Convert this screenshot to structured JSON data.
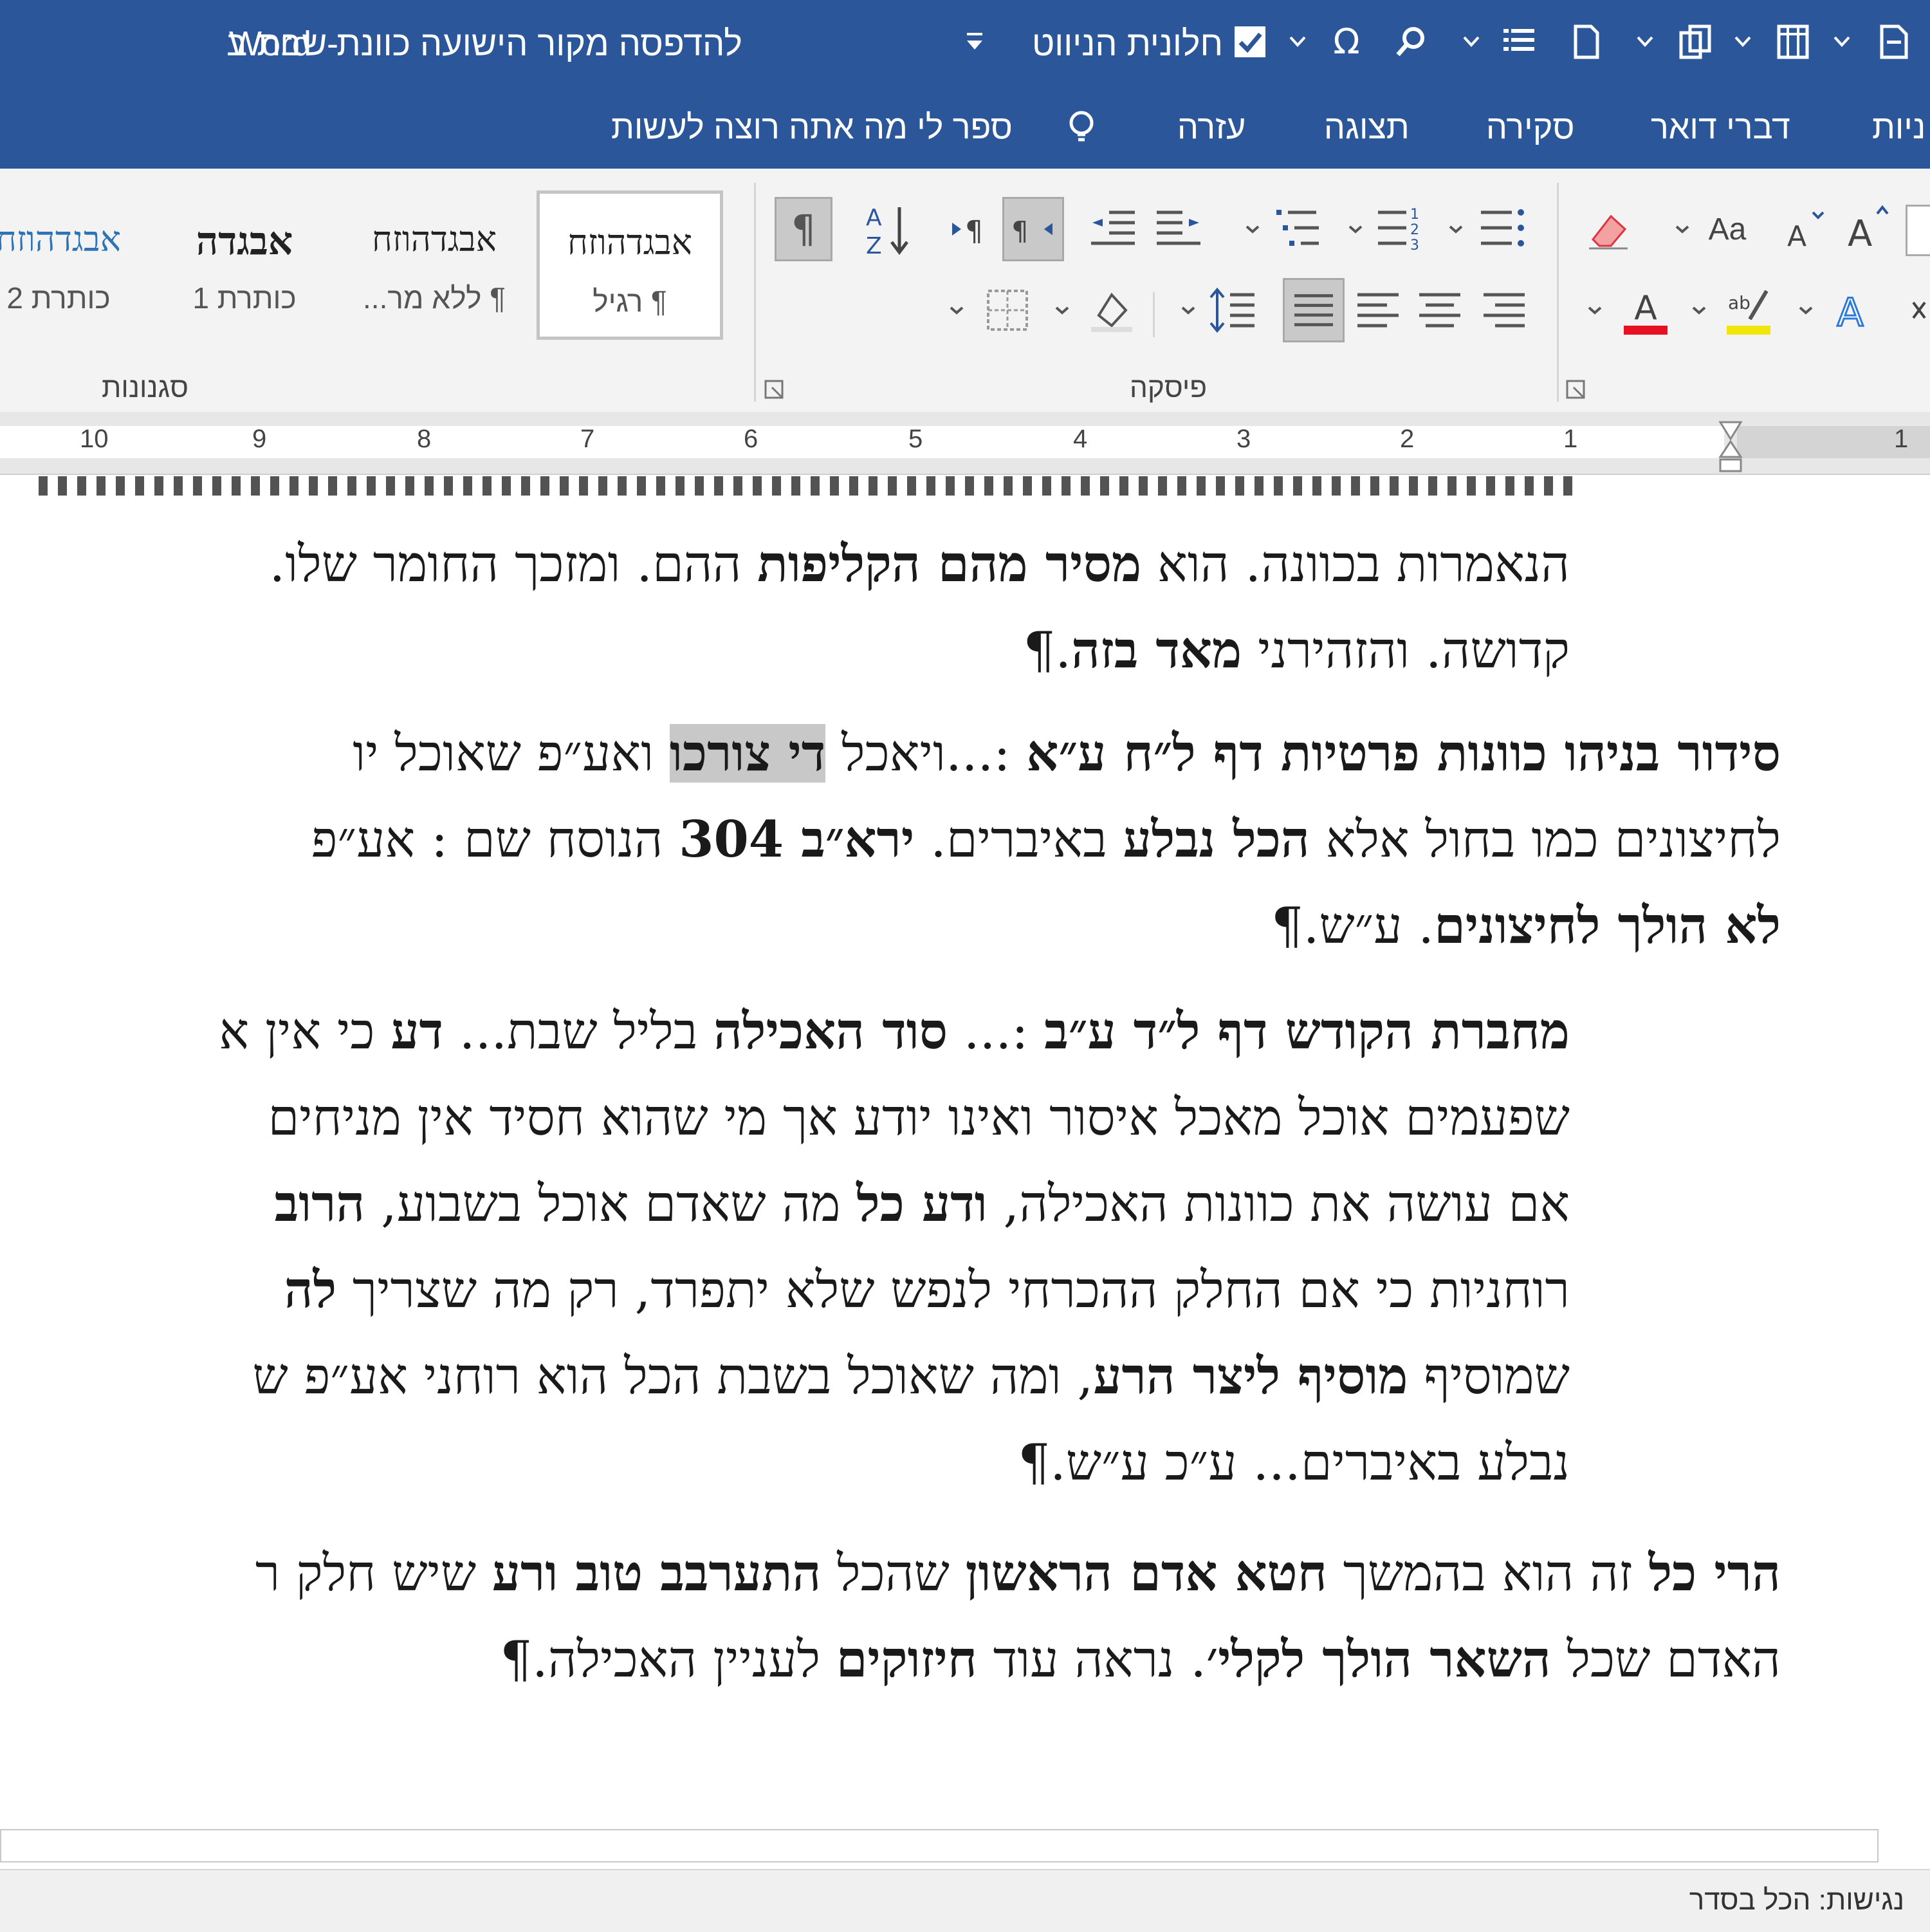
{
  "window": {
    "app": "Word",
    "separator": "-",
    "doc_title": "להדפסה מקור הישועה כוונת שבת ב",
    "nav_pane_label": "חלונית הניווט",
    "nav_pane_checked": true
  },
  "tabs": [
    "עזרה",
    "תצוגה",
    "סקירה",
    "דברי דואר",
    "ניות"
  ],
  "tell_me": "ספר לי מה אתה רוצה לעשות",
  "ribbon": {
    "groups": {
      "styles": "סגנונות",
      "paragraph": "פיסקה"
    },
    "styles": [
      {
        "sample": "אבגדהוזח",
        "name": "¶ רגיל",
        "selected": true
      },
      {
        "sample": "אבגדהוזח",
        "name": "¶ ללא מר...",
        "selected": false
      },
      {
        "sample": "אבגדה",
        "name": "כותרת 1",
        "selected": false
      },
      {
        "sample": "אבגדהוזח",
        "name": "כותרת 2",
        "selected": false
      }
    ],
    "font_case_label": "Aa"
  },
  "ruler": {
    "numbers": [
      "10",
      "9",
      "8",
      "7",
      "6",
      "5",
      "4",
      "3",
      "2",
      "1",
      "1"
    ]
  },
  "document": {
    "p0": {
      "l0a": "הנאמרות בכוונה. הוא ",
      "l0b": "מסיר מהם הקליפות",
      "l0c": " ההם. ומזכך החומר שלו.",
      "l1a": "קדושה. והזהירני ",
      "l1b": "מאד בזה",
      "l1c": ".¶"
    },
    "p1": {
      "l0a": "סידור בניהו כוונות פרטיות דף ל״ח ע״א",
      "l0b": " :...ויאכל ",
      "l0c": "די צורכו",
      "l0d": " ואע״פ שאוכל יו",
      "l1a": "לחיצונים כמו בחול אלא ",
      "l1b": "הכל נבלע",
      "l1c": " באיברים. ",
      "l1d": "ירא״ב 304",
      "l1e": " הנוסח שם : אע״פ",
      "l2a": "לא הולך לחיצונים",
      "l2b": ". ע״ש.¶"
    },
    "p2": {
      "l0a": "מחברת הקודש דף ל״ד ע״ב",
      "l0b": " :... ",
      "l0c": "סוד האכילה",
      "l0d": " בליל שבת... ",
      "l0e": "דע",
      "l0f": " כי אין א",
      "l1": "שפעמים אוכל מאכל איסור ואינו יודע אך מי שהוא חסיד אין מניחים",
      "l2a": "אם עושה את כוונות האכילה, ",
      "l2b": "ודע כל",
      "l2c": " מה שאדם אוכל בשבוע, ",
      "l2d": "הרוב",
      "l3a": "רוחניות כי אם החלק ההכרחי לנפש שלא יתפרד, רק מה שצריך ",
      "l3b": "לה",
      "l4a": "שמוסיף ",
      "l4b": "מוסיף ליצר הרע",
      "l4c": ", ומה שאוכל בשבת הכל הוא רוחני אע״פ ש",
      "l5": "נבלע באיברים... ע״כ ע״ש.¶"
    },
    "p3": {
      "l0a": "הרי כל",
      "l0b": " זה הוא בהמשך ",
      "l0c": "חטא אדם הראשון",
      "l0d": " שהכל ",
      "l0e": "התערבב טוב ורע",
      "l0f": " שיש חלק ר",
      "l1a": "האדם שכל ",
      "l1b": "השאר הולך לקלי׳",
      "l1c": ". נראה עוד ",
      "l1d": "חיזוקים",
      "l1e": " לעניין האכילה.¶"
    }
  },
  "status": {
    "text": "נגישות: הכל בסדר"
  },
  "colors": {
    "titlebar": "#2b579a",
    "ribbon": "#f3f3f3",
    "font_color_bar": "#e81123",
    "highlight_bar": "#f0e60c"
  }
}
